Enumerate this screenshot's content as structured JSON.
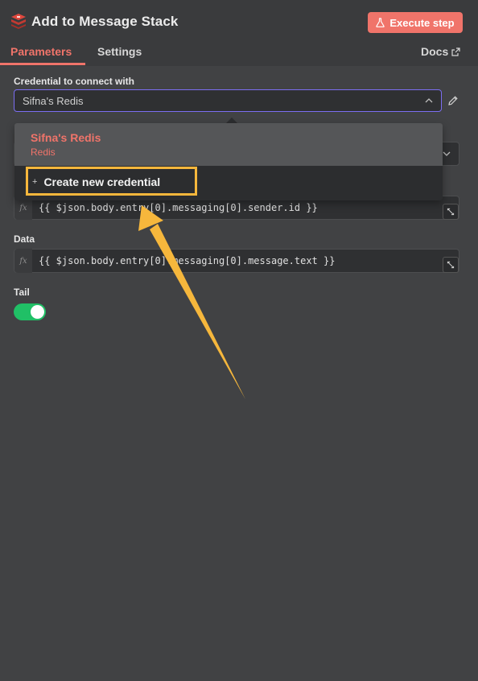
{
  "header": {
    "title": "Add to Message Stack",
    "execute_label": "Execute step",
    "tabs": [
      {
        "label": "Parameters",
        "active": true
      },
      {
        "label": "Settings",
        "active": false
      }
    ],
    "docs_label": "Docs"
  },
  "credential": {
    "label": "Credential to connect with",
    "value": "Sifna's Redis"
  },
  "dropdown": {
    "items": [
      {
        "name": "Sifna's Redis",
        "type": "Redis"
      }
    ],
    "create_label": "Create new credential"
  },
  "fields": {
    "key_value": "{{ $json.body.entry[0].messaging[0].sender.id }}",
    "data_label": "Data",
    "data_value": "{{ $json.body.entry[0].messaging[0].message.text }}",
    "fx": "fx"
  },
  "tail": {
    "label": "Tail",
    "enabled": true
  },
  "colors": {
    "accent": "#f0746a",
    "highlight": "#f6b73c",
    "toggle": "#20c066",
    "focus_border": "#7c6ef2"
  },
  "icons": {
    "logo": "redis-icon",
    "execute": "flask-icon",
    "docs": "external-link-icon",
    "chevron": "chevron-up-icon",
    "edit": "pencil-icon",
    "expand": "expand-icon"
  }
}
